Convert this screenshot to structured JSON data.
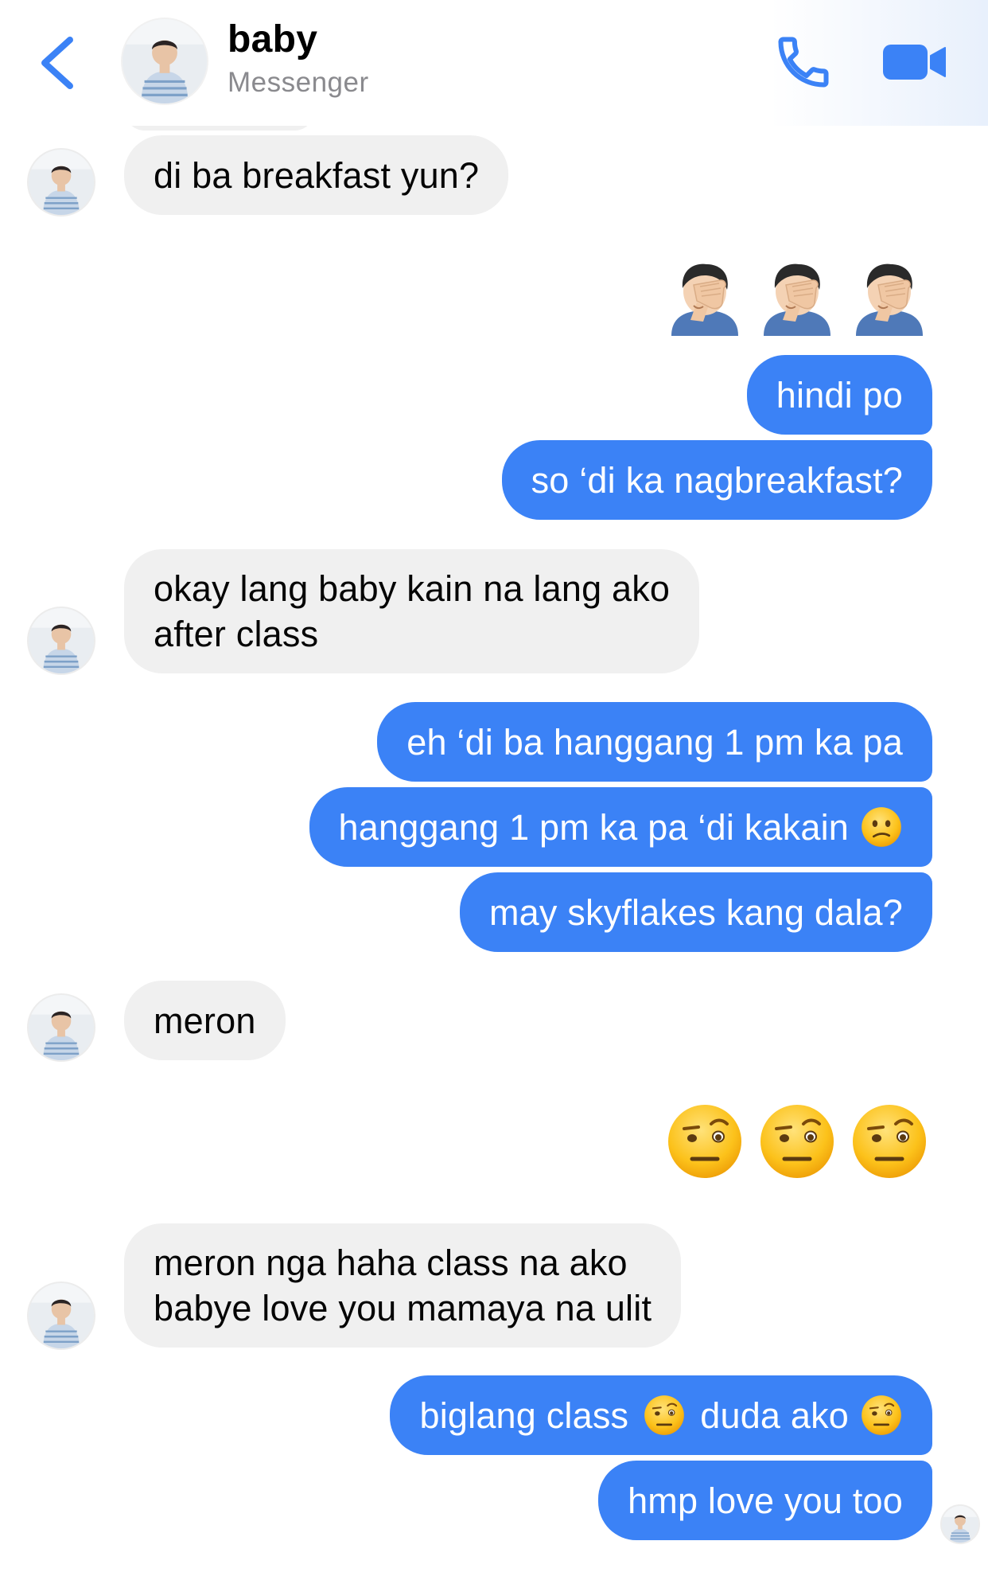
{
  "header": {
    "contact_name": "baby",
    "app_label": "Messenger",
    "colors": {
      "accent": "#3b82f6",
      "incoming_bubble": "#f0f0f0",
      "subtitle": "#8a8a8e"
    }
  },
  "messages": [
    {
      "from": "contact",
      "text": "di ba breakfast yun?"
    },
    {
      "from": "me",
      "emoji": "man-facepalming",
      "count": 3
    },
    {
      "from": "me",
      "text": "hindi po"
    },
    {
      "from": "me",
      "text": "so ‘di ka nagbreakfast?"
    },
    {
      "from": "contact",
      "lines": [
        "okay lang baby kain na lang ako",
        "after class"
      ]
    },
    {
      "from": "me",
      "text": "eh ‘di ba hanggang 1 pm ka pa"
    },
    {
      "from": "me",
      "text": "hanggang 1 pm ka pa ‘di kakain",
      "trailing_emoji": "confused-face"
    },
    {
      "from": "me",
      "text": "may skyflakes kang dala?"
    },
    {
      "from": "contact",
      "text": "meron"
    },
    {
      "from": "me",
      "emoji": "face-with-raised-eyebrow",
      "count": 3
    },
    {
      "from": "contact",
      "lines": [
        "meron nga haha class na ako",
        "babye love you mamaya na ulit"
      ]
    },
    {
      "from": "me",
      "parts": [
        "biglang class",
        "duda ako"
      ],
      "emoji": "face-with-raised-eyebrow"
    },
    {
      "from": "me",
      "text": "hmp love you too",
      "seen": true
    }
  ]
}
